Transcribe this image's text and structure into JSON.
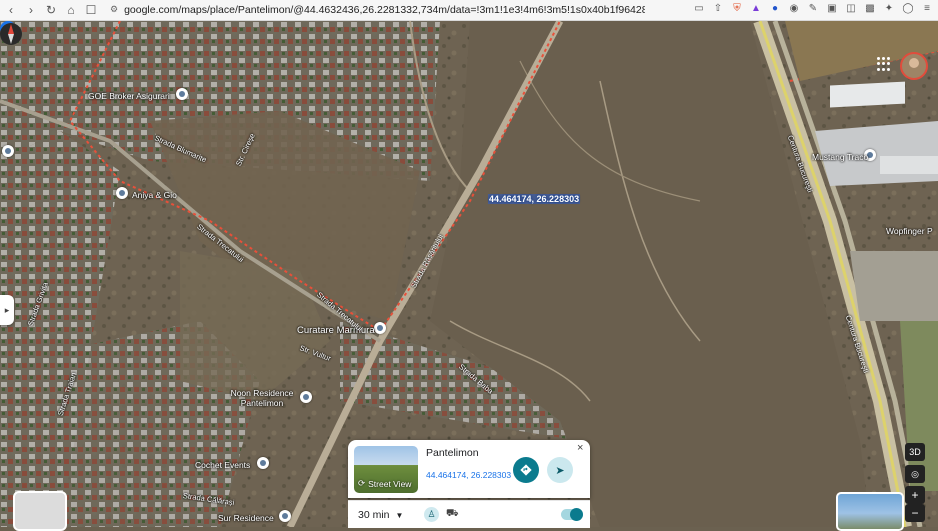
{
  "browser": {
    "url": "google.com/maps/place/Pantelimon/@44.4632436,26.2281332,734m/data=!3m1!1e3!4m6!3m5!1s0x40b1f96428bce..."
  },
  "map": {
    "pin_coords": "44.464174, 26.228303",
    "places": [
      {
        "name": "GOE Broker Asigurari"
      },
      {
        "name": "Aniya & Gio"
      },
      {
        "name": "Curatare Marmura"
      },
      {
        "name": "Noon Residence Pantelimon"
      },
      {
        "name": "Cochet Events"
      },
      {
        "name": "Sur Residence"
      },
      {
        "name": "Mustang Traco"
      },
      {
        "name": "Wopfinger P"
      }
    ],
    "streets": [
      {
        "name": "Strada Blumarite"
      },
      {
        "name": "Str. Cireșe"
      },
      {
        "name": "Strada Trecatului"
      },
      {
        "name": "Strada Răsăritului"
      },
      {
        "name": "Strada Grivita"
      },
      {
        "name": "Strada Traian"
      },
      {
        "name": "Centura Bucureşti"
      },
      {
        "name": "Strada Baba"
      },
      {
        "name": "Strada Călărași"
      },
      {
        "name": "Str. Vultur"
      }
    ]
  },
  "controls": {
    "view_3d": "3D",
    "zoom_in": "+",
    "zoom_out": "−"
  },
  "card": {
    "title": "Pantelimon",
    "coords": "44.464174, 26.228303",
    "street_view_label": "Street View",
    "close": "×"
  },
  "bottom_bar": {
    "time": "30 min"
  },
  "colors": {
    "accent": "#0b7b8e",
    "link": "#1a73e8",
    "pin": "#1a73e8",
    "boundary": "#e8503a"
  }
}
